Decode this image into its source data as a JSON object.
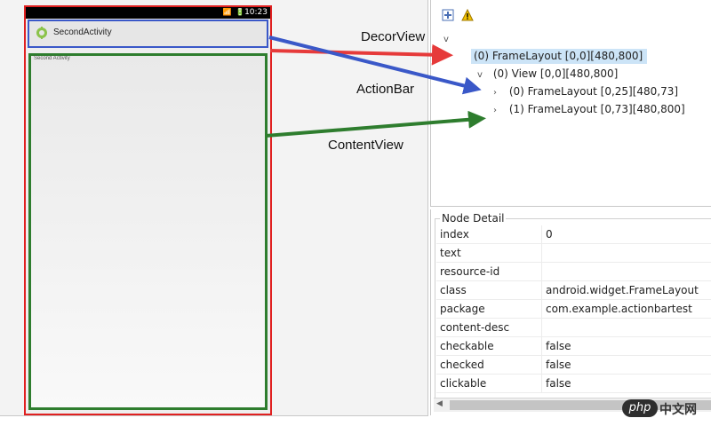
{
  "device": {
    "status_time": "10:23",
    "status_icons": "📶 🔋",
    "actionbar_title": "SecondActivity",
    "content_text": "Second Activity"
  },
  "annotations": {
    "decor_view": "DecorView",
    "action_bar": "ActionBar",
    "content_view": "ContentView"
  },
  "hierarchy": {
    "rows": [
      {
        "label": "(0) FrameLayout [0,0][480,800]"
      },
      {
        "label": "(0) View [0,0][480,800]"
      },
      {
        "label": "(0) FrameLayout [0,25][480,73]"
      },
      {
        "label": "(1) FrameLayout [0,73][480,800]"
      }
    ]
  },
  "node_detail": {
    "legend": "Node Detail",
    "rows": [
      {
        "key": "index",
        "value": "0"
      },
      {
        "key": "text",
        "value": ""
      },
      {
        "key": "resource-id",
        "value": ""
      },
      {
        "key": "class",
        "value": "android.widget.FrameLayout"
      },
      {
        "key": "package",
        "value": "com.example.actionbartest"
      },
      {
        "key": "content-desc",
        "value": ""
      },
      {
        "key": "checkable",
        "value": "false"
      },
      {
        "key": "checked",
        "value": "false"
      },
      {
        "key": "clickable",
        "value": "false"
      }
    ]
  },
  "watermark": {
    "php": "php",
    "cn": "中文网"
  },
  "colors": {
    "decor_arrow": "#e63a3a",
    "actionbar_arrow": "#3a58c8",
    "content_arrow": "#2e7d2e",
    "selection": "#cce4f7"
  }
}
